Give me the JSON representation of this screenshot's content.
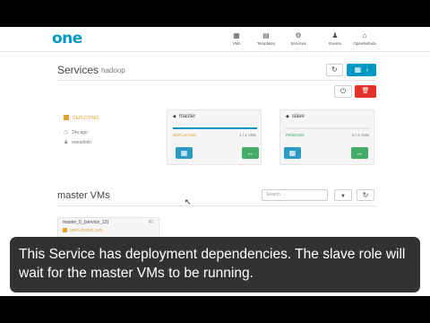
{
  "app": {
    "logo": "one"
  },
  "nav": [
    {
      "icon": "▦",
      "label": "VMs"
    },
    {
      "icon": "▤",
      "label": "Templates"
    },
    {
      "icon": "⚙",
      "label": "Services"
    },
    {
      "icon": "♟",
      "label": "Events"
    },
    {
      "icon": "⌂",
      "label": "OpenNebula"
    }
  ],
  "service": {
    "title": "Services",
    "name": "hadoop",
    "refresh_icon": "↻",
    "grid_icon": "▦",
    "back_icon": "‹",
    "power_icon": "⏻",
    "delete_icon": "🗑",
    "state": "DEPLOYING",
    "time": "24s ago",
    "owner": "oneadmin",
    "clock_icon": "◷",
    "user_icon": "♟"
  },
  "roles": [
    {
      "icon": "◆",
      "name": "master",
      "status": "DEPLOYING",
      "count": "1 / 1 VMs",
      "status_color": "#e3a02a",
      "progress": 1.0,
      "grid_icon": "▦",
      "scale_icon": "↔"
    },
    {
      "icon": "◆",
      "name": "slave",
      "status": "PENDING",
      "count": "0 / 4 VMs",
      "status_color": "#43ac6a",
      "progress": 0.0,
      "grid_icon": "▦",
      "scale_icon": "↔"
    }
  ],
  "vms": {
    "title": "master VMs",
    "search_placeholder": "Search",
    "filter_icon": "▼",
    "refresh_icon": "↻",
    "card": {
      "name": "master_0_(service_13)",
      "id": "40",
      "state": "DEPLOYING (1/0)"
    }
  },
  "caption": "This Service has deployment dependencies. The slave role will wait for the master VMs to be running.",
  "cursor": "↖"
}
